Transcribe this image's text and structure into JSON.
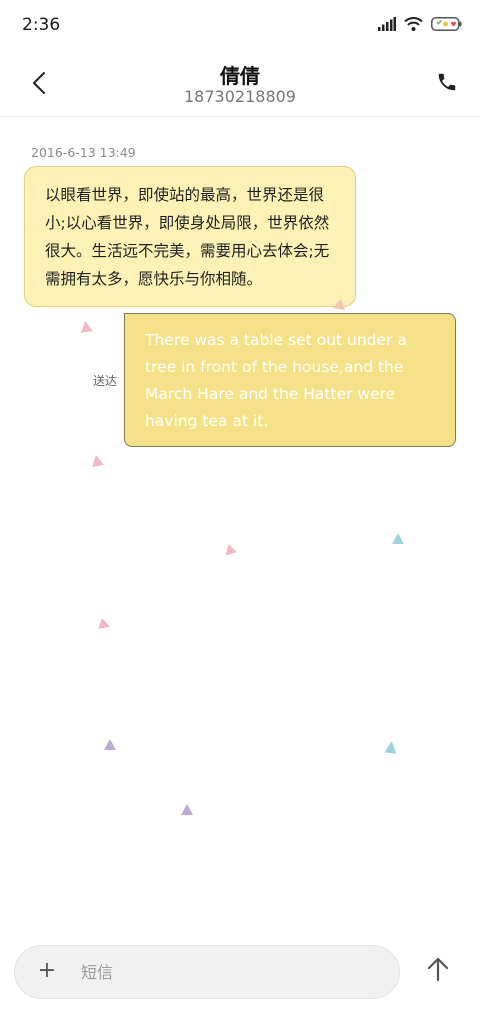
{
  "status_bar": {
    "time": "2:36",
    "icons": [
      "signal-icon",
      "wifi-icon",
      "battery-icon"
    ]
  },
  "header": {
    "contact_name": "倩倩",
    "contact_number": "18730218809",
    "back_icon": "chevron-left-icon",
    "call_icon": "phone-icon"
  },
  "conversation": {
    "timestamp": "2016-6-13 13:49",
    "incoming_message": "以眼看世界，即使站的最高，世界还是很小;以心看世界，即使身处局限，世界依然很大。生活远不完美，需要用心去体会;无需拥有太多，愿快乐与你相随。",
    "outgoing_message": "There was a table set out under a tree in front of the house,and the March Hare and the Hatter were having tea at it.",
    "outgoing_status": "送达"
  },
  "composer": {
    "plus_label": "+",
    "placeholder": "短信",
    "send_icon": "arrow-up-icon"
  },
  "colors": {
    "incoming_bubble": "#fdf2b6",
    "outgoing_bubble": "#f5e288",
    "triangle_pink": "#f2b8c6",
    "triangle_purple": "#bfaad8",
    "triangle_teal": "#9fd3dc",
    "triangle_peach": "#f5c4ae"
  }
}
